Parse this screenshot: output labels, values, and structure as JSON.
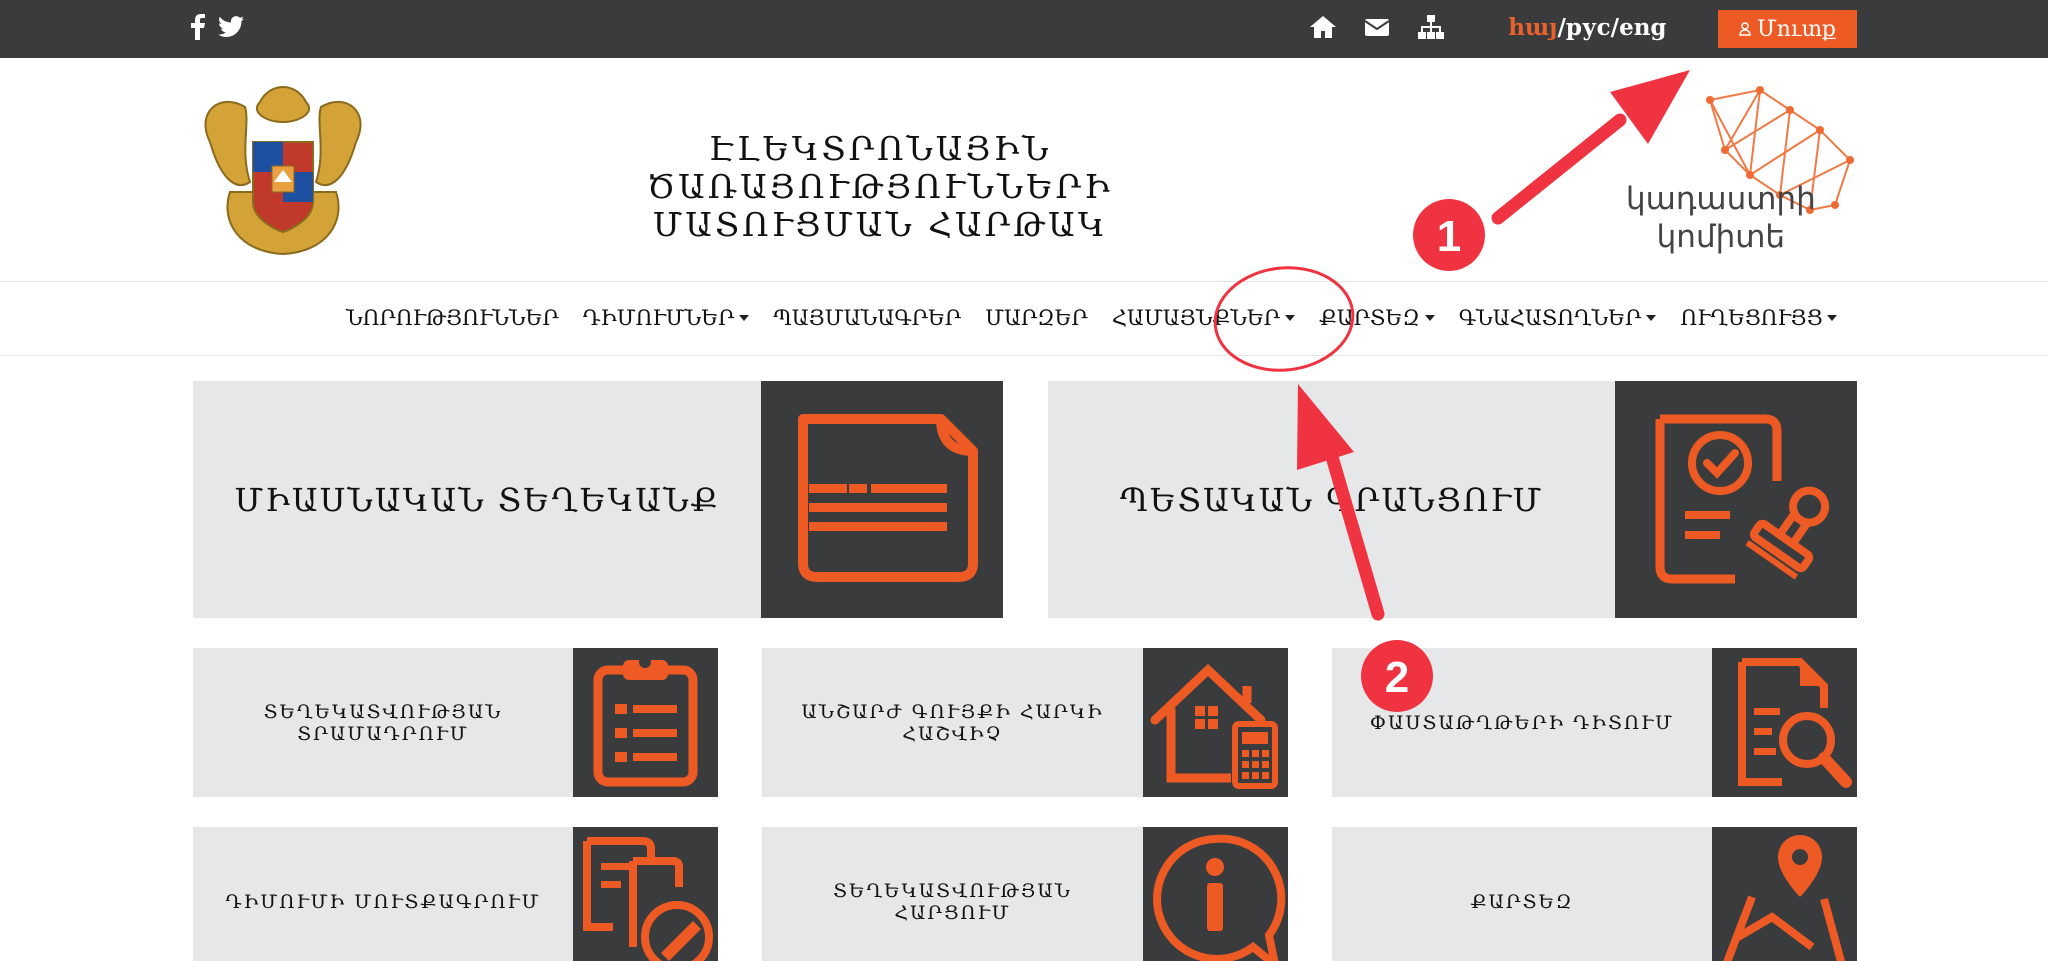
{
  "topbar": {
    "social_icons": [
      "facebook-icon",
      "twitter-icon"
    ],
    "icons": [
      "home-icon",
      "mail-icon",
      "sitemap-icon"
    ],
    "lang_active": "հայ",
    "lang_rest": "/рус/eng",
    "login_label": "Մուտք"
  },
  "header": {
    "title_line1": "ԷԼԵԿՏՐՈՆԱՅԻՆ ԾԱՌԱՅՈՒԹՅՈՒՆՆԵՐԻ",
    "title_line2": "ՄԱՏՈՒՑՄԱՆ ՀԱՐԹԱԿ",
    "partner_line1": "կադաստրի",
    "partner_line2": "կոմիտե"
  },
  "nav": {
    "items": [
      {
        "label": "ՆՈՐՈՒԹՅՈՒՆՆԵՐ",
        "dropdown": false
      },
      {
        "label": "ԴԻՄՈՒՄՆԵՐ",
        "dropdown": true
      },
      {
        "label": "ՊԱՅՄԱՆԱԳՐԵՐ",
        "dropdown": false
      },
      {
        "label": "ՄԱՐԶԵՐ",
        "dropdown": false
      },
      {
        "label": "ՀԱՄԱՅՆՔՆԵՐ",
        "dropdown": true
      },
      {
        "label": "ՔԱՐՏԵԶ",
        "dropdown": true
      },
      {
        "label": "ԳՆԱՀԱՏՈՂՆԵՐ",
        "dropdown": true
      },
      {
        "label": "ՈՒՂԵՑՈՒՅՑ",
        "dropdown": true
      }
    ]
  },
  "tiles": {
    "big": [
      {
        "label": "ՄԻԱՍՆԱԿԱՆ ՏԵՂԵԿԱՆՔ",
        "icon": "document-icon"
      },
      {
        "label": "ՊԵՏԱԿԱՆ ԳՐԱՆՑՈՒՄ",
        "icon": "certificate-stamp-icon"
      }
    ],
    "small": [
      {
        "label1": "ՏԵՂԵԿԱՏՎՈՒԹՅԱՆ",
        "label2": "ՏՐԱՄԱԴՐՈՒՄ",
        "icon": "clipboard-list-icon"
      },
      {
        "label1": "ԱՆՇԱՐԺ ԳՈՒՅՔԻ ՀԱՐԿԻ",
        "label2": "ՀԱՇՎԻՉ",
        "icon": "house-calculator-icon"
      },
      {
        "label1": "ՓԱՍՏԱԹՂԹԵՐԻ ԴԻՏՈՒՄ",
        "label2": "",
        "icon": "document-search-icon"
      },
      {
        "label1": "ԴԻՄՈՒՄԻ ՄՈՒՏՔԱԳՐՈՒՄ",
        "label2": "",
        "icon": "document-edit-icon"
      },
      {
        "label1": "ՏԵՂԵԿԱՏՎՈՒԹՅԱՆ",
        "label2": "ՀԱՐՑՈՒՄ",
        "icon": "info-chat-icon"
      },
      {
        "label1": "ՔԱՐՏԵԶ",
        "label2": "",
        "icon": "map-pin-icon"
      }
    ]
  },
  "annotations": {
    "badge1": "1",
    "badge2": "2"
  },
  "colors": {
    "topbar": "#3a3b3d",
    "accent": "#ee5a24",
    "tile_bg": "#e6e7e9",
    "annotation_red": "#ef3340"
  }
}
